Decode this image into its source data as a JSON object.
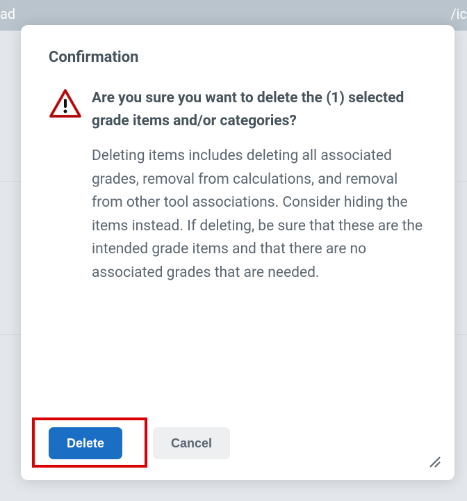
{
  "background": {
    "left_fragment": "ad",
    "right_fragment": "/ic"
  },
  "dialog": {
    "title": "Confirmation",
    "question": "Are you sure you want to delete the (1) selected grade items and/or categories?",
    "detail": "Deleting items includes deleting all associated grades, removal from calculations, and removal from other tool associations. Consider hiding the items instead. If deleting, be sure that these are the intended grade items and that there are no associated grades that are needed.",
    "buttons": {
      "delete": "Delete",
      "cancel": "Cancel"
    },
    "icon": "warning-triangle-icon"
  },
  "annotation": {
    "highlighted_button": "delete"
  }
}
